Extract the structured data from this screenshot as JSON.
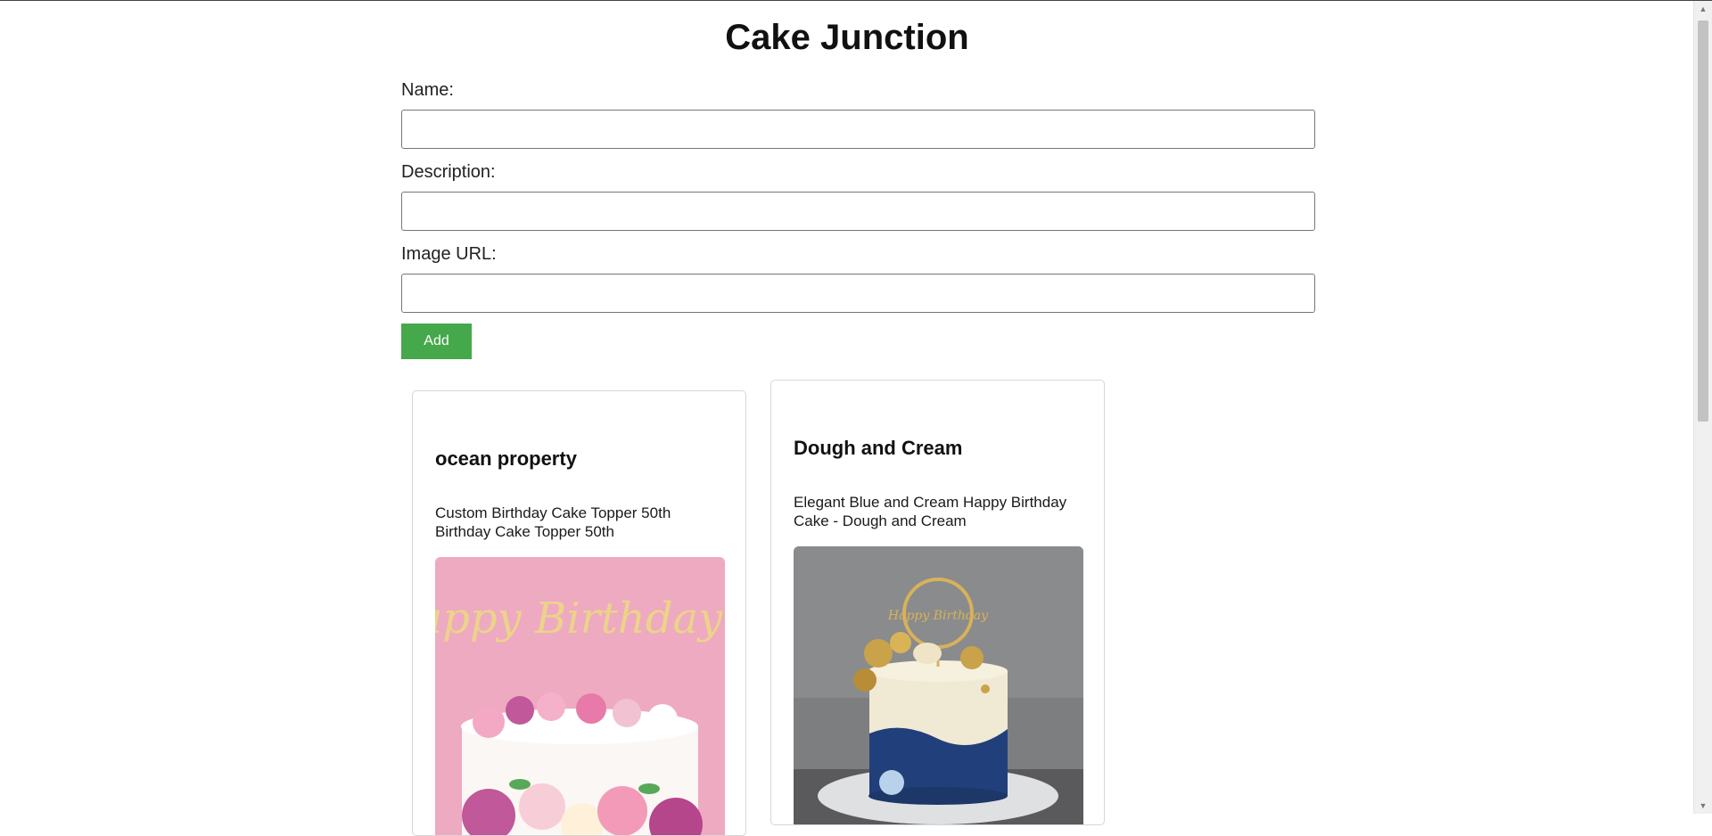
{
  "app": {
    "title": "Cake Junction"
  },
  "form": {
    "name_label": "Name:",
    "name_value": "",
    "description_label": "Description:",
    "description_value": "",
    "image_url_label": "Image URL:",
    "image_url_value": "",
    "add_label": "Add",
    "add_color": "#45a84a"
  },
  "cards": [
    {
      "name": "ocean property",
      "description": "Custom Birthday Cake Topper 50th Birthday Cake Topper 50th",
      "image_icon": "cake-image-pink-happy-birthday",
      "image_text": "Happy Birthday"
    },
    {
      "name": "Dough and Cream",
      "description": "Elegant Blue and Cream Happy Birthday Cake - Dough and Cream",
      "image_icon": "cake-image-blue-gold",
      "image_text": "Happy Birthday"
    }
  ],
  "colors": {
    "accent": "#45a84a",
    "border": "#d6d6d6"
  }
}
